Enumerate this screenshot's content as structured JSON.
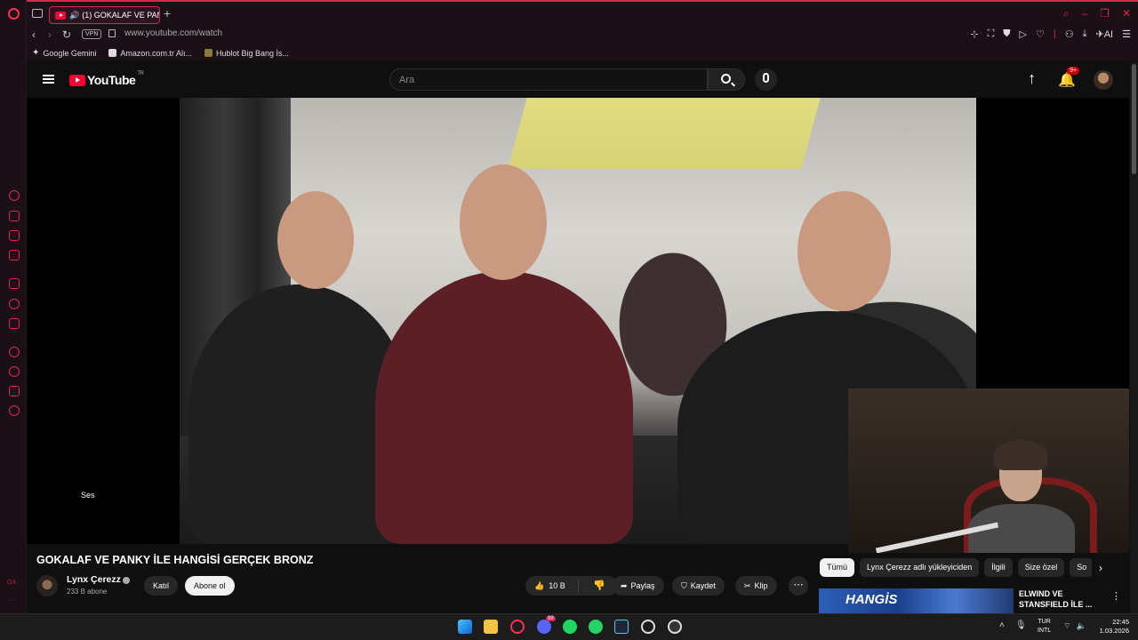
{
  "browser": {
    "tab_title": "(1) GOKALAF VE PANK",
    "url": "www.youtube.com/watch",
    "vpn_label": "VPN",
    "bookmarks": [
      {
        "label": "Google Gemini",
        "icon": "gemini-icon"
      },
      {
        "label": "Amazon.com.tr Alı...",
        "icon": "amazon-icon"
      },
      {
        "label": "Hublot Big Bang İs...",
        "icon": "hublot-icon"
      }
    ],
    "ai_label": "AI",
    "accent_color": "#d6274c"
  },
  "youtube": {
    "logo_text": "YouTube",
    "country_code": "TR",
    "search_placeholder": "Ara",
    "notification_count": "9+"
  },
  "player": {
    "volume_label": "Ses"
  },
  "video": {
    "title": "GOKALAF VE PANKY İLE HANGİSİ GERÇEK BRONZ",
    "channel_name": "Lynx Çerezz",
    "subscribers": "233 B abone",
    "join_label": "Katıl",
    "subscribe_label": "Abone ol",
    "likes": "10 B",
    "share_label": "Paylaş",
    "save_label": "Kaydet",
    "clip_label": "Klip",
    "more_label": "⋯"
  },
  "recommendations": {
    "chips": [
      "Tümü",
      "Lynx Çerezz adlı yükleyiciden",
      "İlgili",
      "Size özel",
      "So"
    ],
    "items": [
      {
        "title": "ELWIND VE STANSFIELD İLE ...",
        "thumb_text": "HANGİS"
      }
    ]
  },
  "taskbar": {
    "discord_badge": "99",
    "language_line1": "TUR",
    "language_line2": "INTL",
    "time": "22:45",
    "date": "1.03.2026"
  }
}
